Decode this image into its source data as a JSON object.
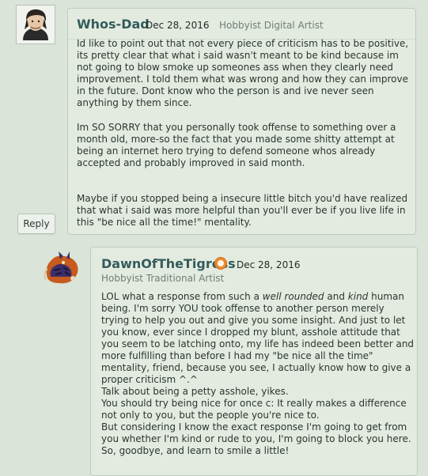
{
  "comments": [
    {
      "username": "Whos-Dad",
      "date": "Dec 28, 2016",
      "role": "Hobbyist Digital Artist",
      "paragraphs": [
        "Id like to point out that not every piece of criticism has to be positive,\nits pretty clear that what i said wasn't meant to be kind because im\nnot going to blow smoke up someones ass when they clearly need\nimprovement. I told them what was wrong and how they can improve\nin the future. Dont know who the person is and ive never seen\nanything by them since.",
        "Im SO SORRY that you personally took offense to something over a\nmonth old, more-so the fact that you made some shitty attempt at\nbeing an internet hero trying to defend someone whos already\naccepted and probably improved in said month.",
        "Maybe if you stopped being a insecure little bitch you'd have realized\nthat what i said was more helpful than you'll ever be if you live life in\nthis \"be nice all the time!\" mentality."
      ],
      "reply_label": "Reply"
    },
    {
      "username": "DawnOfTheTigress",
      "date": "Dec 28, 2016",
      "role": "Hobbyist Traditional Artist",
      "line1_a": "LOL what a response from such a ",
      "line1_em1": "well rounded",
      "line1_b": " and ",
      "line1_em2": "kind",
      "line1_c": " human",
      "body_rest": "being. I'm sorry YOU took offense to another person merely\ntrying to help you out and give you some insight. And just to let\nyou know, ever since I dropped my blunt, asshole attitude that\nyou seem to be latching onto, my life has indeed been better and\nmore fulfilling than before I had my \"be nice all the time\"\nmentality, friend, because you see, I actually know how to give a\nproper criticism ^.^\nTalk about being a petty asshole, yikes.\nYou should try being nice for once c: It really makes a difference\nnot only to you, but the people you're nice to.\nBut considering I know the exact response I'm going to get from\nyou whether I'm kind or rude to you, I'm going to block you here.\nSo, goodbye, and learn to smile a little!"
    }
  ],
  "icons": {
    "avatar1": "user-avatar-icon",
    "avatar2": "tiger-avatar-icon",
    "badge": "deviant-badge-icon"
  },
  "colors": {
    "background": "#dae4d9",
    "comment_bg": "#e3ebe1",
    "username": "#345c5a",
    "badge": "#ef8a2e"
  }
}
